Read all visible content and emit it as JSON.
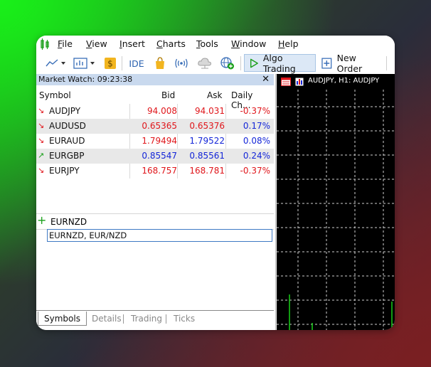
{
  "menu": {
    "items": [
      {
        "label": "File",
        "u": "F",
        "rest": "ile"
      },
      {
        "label": "View",
        "u": "V",
        "rest": "iew"
      },
      {
        "label": "Insert",
        "u": "I",
        "rest": "nsert"
      },
      {
        "label": "Charts",
        "u": "C",
        "rest": "harts"
      },
      {
        "label": "Tools",
        "u": "T",
        "rest": "ools"
      },
      {
        "label": "Window",
        "u": "W",
        "rest": "indow"
      },
      {
        "label": "Help",
        "u": "H",
        "rest": "elp"
      }
    ]
  },
  "toolbar": {
    "ide_label": "IDE",
    "algo_label": "Algo Trading",
    "neworder_label": "New Order"
  },
  "market_watch": {
    "title": "Market Watch: 09:23:38",
    "close": "✕",
    "columns": [
      "Symbol",
      "Bid",
      "Ask",
      "Daily Ch..."
    ],
    "rows": [
      {
        "dir": "down",
        "symbol": "AUDJPY",
        "bid": "94.008",
        "ask": "94.031",
        "change": "-0.37%",
        "color": "red"
      },
      {
        "dir": "down",
        "symbol": "AUDUSD",
        "bid": "0.65365",
        "ask": "0.65376",
        "change": "0.17%",
        "color": "red"
      },
      {
        "dir": "down",
        "symbol": "EURAUD",
        "bid": "1.79494",
        "ask": "1.79522",
        "change": "0.08%",
        "color": "red"
      },
      {
        "dir": "up",
        "symbol": "EURGBP",
        "bid": "0.85547",
        "ask": "0.85561",
        "change": "0.24%",
        "color": "blue"
      },
      {
        "dir": "down",
        "symbol": "EURJPY",
        "bid": "168.757",
        "ask": "168.781",
        "change": "-0.37%",
        "color": "red"
      }
    ],
    "add_symbol_value": "EURNZD",
    "suggestion": "EURNZD,  EUR/NZD",
    "tabs": [
      "Symbols",
      "Details",
      "Trading",
      "Ticks"
    ]
  },
  "chart": {
    "title": "AUDJPY, H1:  AUDJPY"
  },
  "colors": {
    "down": "#e0161b",
    "up": "#1426d8",
    "arrow_down": "#e0161b",
    "arrow_up": "#1aa01a"
  }
}
